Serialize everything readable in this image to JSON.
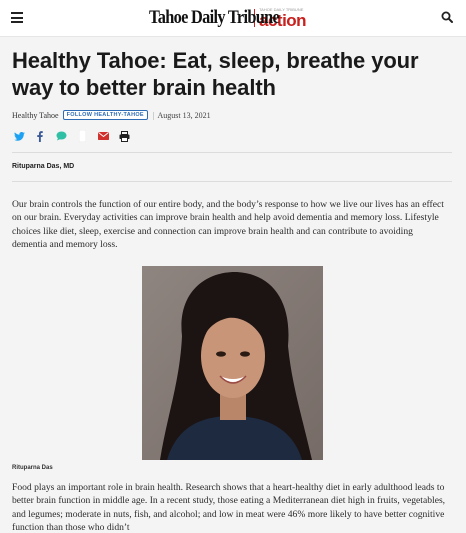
{
  "header": {
    "brand_name": "Tahoe Daily Tribune",
    "brand_small": "TAHOE DAILY TRIBUNE",
    "brand_action": "action",
    "icons": [
      "menu-icon",
      "search-icon"
    ]
  },
  "article": {
    "headline": "Healthy Tahoe: Eat, sleep, breathe your way to better brain health",
    "section": "Healthy Tahoe",
    "follow_label": "FOLLOW HEALTHY-TAHOE",
    "separator": "|",
    "date": "August 13, 2021",
    "author": "Rituparna Das, MD",
    "share_icons": [
      "twitter-icon",
      "facebook-icon",
      "sms-icon",
      "more-icon",
      "email-icon",
      "print-icon"
    ],
    "paragraph1": "Our brain controls the function of our entire body, and the body’s response to how we live our lives has an effect on our brain. Everyday activities can improve brain health and help avoid dementia and memory loss. Lifestyle choices like diet, sleep, exercise and connection can improve brain health and can contribute to avoiding dementia and memory loss.",
    "photo_caption": "Rituparna Das",
    "paragraph2": "Food plays an important role in brain health. Research shows that a heart-healthy diet in early adulthood leads to better brain function in middle age. In a recent study, those eating a Mediterranean diet high in fruits, vegetables, and legumes; moderate in nuts, fish, and alcohol; and low in meat were 46% more likely to have better cognitive function than those who didn’t"
  },
  "colors": {
    "brand_red": "#c8201d",
    "link_blue": "#2d6bb5",
    "twitter": "#1da1f2",
    "facebook": "#3b5998",
    "sms": "#2ebfa5",
    "email": "#d0312d"
  }
}
